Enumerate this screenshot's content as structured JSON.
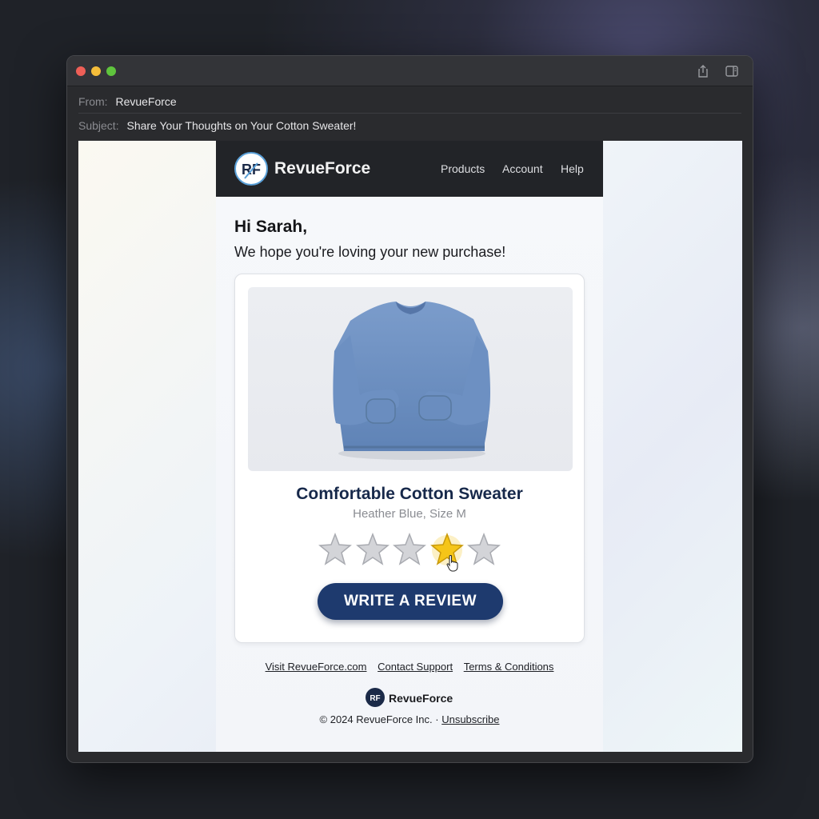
{
  "email": {
    "from_label": "From:",
    "from_value": "RevueForce",
    "subject_label": "Subject:",
    "subject_value": "Share Your Thoughts on Your Cotton Sweater!"
  },
  "brand": {
    "name": "RevueForce",
    "logo_text": "RF",
    "nav": [
      "Products",
      "Account",
      "Help"
    ]
  },
  "greeting": {
    "title": "Hi Sarah,",
    "message": "We hope you're loving your new purchase!"
  },
  "product": {
    "name": "Comfortable Cotton Sweater",
    "variant": "Heather Blue, Size M",
    "image_icon": "sweater-image",
    "color": "#6b8fc0"
  },
  "rating": {
    "max": 5,
    "hovered": 4,
    "filled_color": "#f5c518",
    "empty_color": "#d3d4d8"
  },
  "cta": {
    "label": "WRITE A REVIEW",
    "color": "#1e3a6e"
  },
  "footer": {
    "links": [
      "Visit RevueForce.com",
      "Contact Support",
      "Terms & Conditions"
    ],
    "brand": "RevueForce",
    "copyright": "© 2024 RevueForce Inc. ·",
    "unsubscribe": "Unsubscribe"
  }
}
